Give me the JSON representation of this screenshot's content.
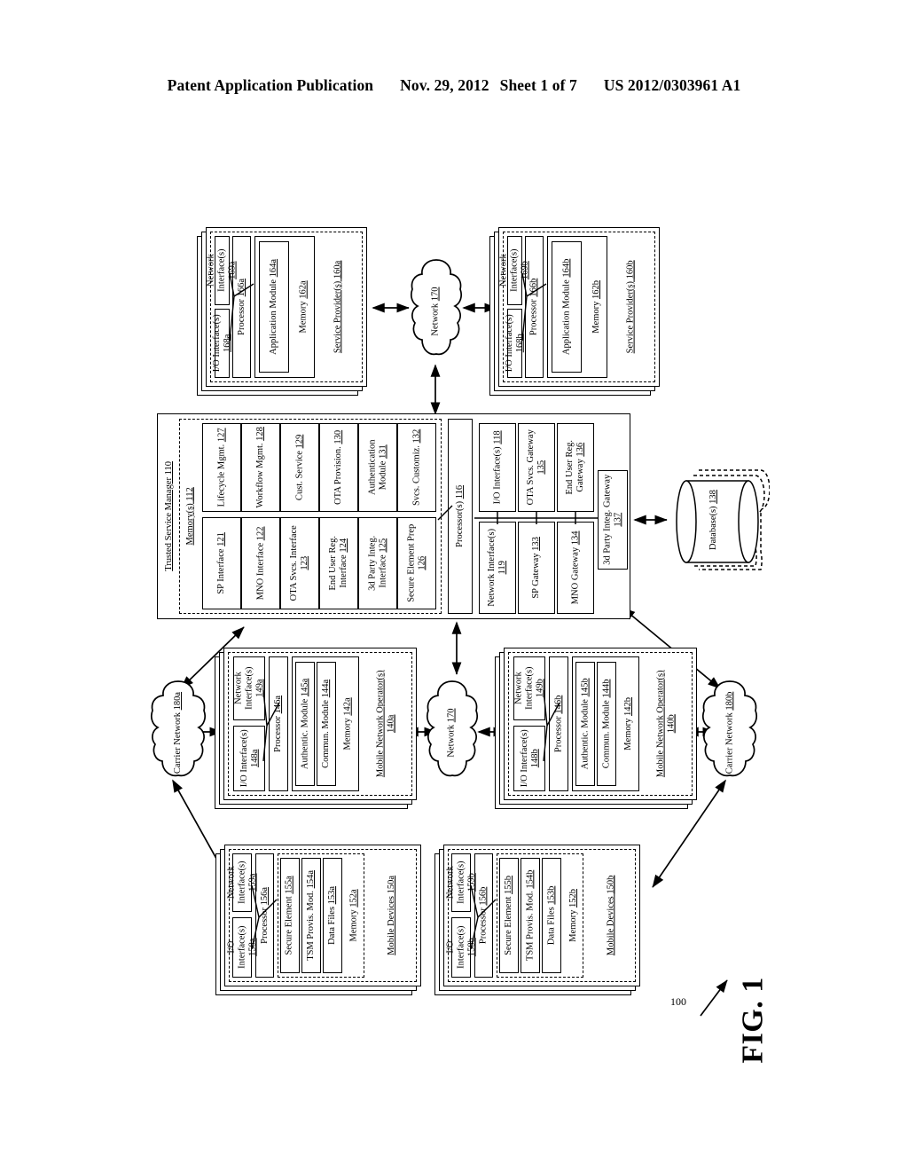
{
  "header": {
    "publication": "Patent Application Publication",
    "date": "Nov. 29, 2012",
    "sheet": "Sheet 1 of 7",
    "docnum": "US 2012/0303961 A1"
  },
  "figure": {
    "label": "FIG. 1",
    "system_ref": "100"
  },
  "service_providers": [
    {
      "title": "Service Provider(s) 160a",
      "memory": "Memory 162a",
      "application_module": "Application Module 164a",
      "processor": "Processor 166a",
      "network_interface": "Network Interface(s) 169a",
      "io_interface": "I/O Interface(s) 168a"
    },
    {
      "title": "Service Provider(s) 160b",
      "memory": "Memory 162b",
      "application_module": "Application Module 164b",
      "processor": "Processor 166b",
      "network_interface": "Network Interface(s) 169b",
      "io_interface": "I/O Interface(s) 168b"
    }
  ],
  "tsm": {
    "title": "Trusted Service Manager 110",
    "memory": "Memory(s) 112",
    "memory_modules_row_top": [
      "Lifecycle Mgmt. 127",
      "Workflow Mgmt. 128",
      "Cust. Service 129",
      "OTA Provision. 130",
      "Authentication Module 131",
      "Svcs. Customiz. 132"
    ],
    "memory_modules_row_bottom": [
      "SP Interface 121",
      "MNO Interface 122",
      "OTA Svcs. Interface 123",
      "End User Reg. Interface 124",
      "3d Party Integ. Interface 125",
      "Secure Element Prep 126"
    ],
    "processor": "Processor(s) 116",
    "interfaces_row_top": [
      "I/O Interface(s) 118",
      "OTA Svcs. Gateway 135",
      "End User Reg. Gateway 136"
    ],
    "interfaces_row_bottom": [
      "Network Interface(s) 119",
      "SP Gateway 133",
      "MNO Gateway 134"
    ],
    "third_party_gateway": "3d Party Integ. Gateway 137"
  },
  "database": {
    "label": "Database(s) 138"
  },
  "networks": {
    "top": "Network 170",
    "middle": "Network 170",
    "carrier_left": "Carrier Network 180a",
    "carrier_right": "Carrier Network 180b"
  },
  "mobile_network_operators": [
    {
      "title": "Mobile Network Operator(s) 140a",
      "memory": "Memory 142a",
      "commun_module": "Commun. Module 144a",
      "authentic_module": "Authentic. Module 145a",
      "processor": "Processor 146a",
      "network_interface": "Network Interface(s) 149a",
      "io_interface": "I/O Interface(s) 148a"
    },
    {
      "title": "Mobile Network Operator(s) 140b",
      "memory": "Memory 142b",
      "commun_module": "Commun. Module 144b",
      "authentic_module": "Authentic. Module 145b",
      "processor": "Processor 146b",
      "network_interface": "Network Interface(s) 149b",
      "io_interface": "I/O Interface(s) 148b"
    }
  ],
  "mobile_devices": [
    {
      "title": "Mobile Devices 150a",
      "memory": "Memory 152a",
      "data_files": "Data Files 153a",
      "tsm_provis_mod": "TSM Provis. Mod. 154a",
      "secure_element": "Secure Element 155a",
      "processor": "Processor 156a",
      "network_interface": "Network Interface(s) 159a",
      "io_interface": "I/O Interface(s) 158a"
    },
    {
      "title": "Mobile Devices 150b",
      "memory": "Memory 152b",
      "data_files": "Data Files 153b",
      "tsm_provis_mod": "TSM Provis. Mod. 154b",
      "secure_element": "Secure Element 155b",
      "processor": "Processor 156b",
      "network_interface": "Network Interface(s) 159b",
      "io_interface": "I/O Interface(s) 158b"
    }
  ]
}
